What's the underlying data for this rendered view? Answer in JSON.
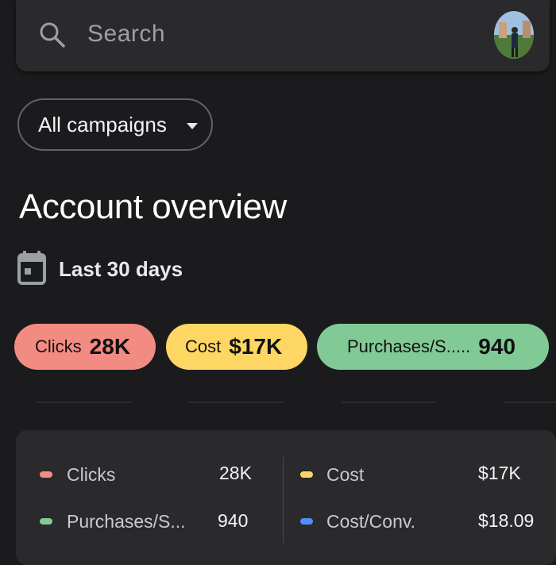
{
  "search": {
    "placeholder": "Search"
  },
  "campaign_filter": {
    "label": "All campaigns"
  },
  "page": {
    "title": "Account overview",
    "date_range": "Last 30 days"
  },
  "chips": [
    {
      "label": "Clicks",
      "value": "28K",
      "color": "#f28b82"
    },
    {
      "label": "Cost",
      "value": "$17K",
      "color": "#fdd663"
    },
    {
      "label": "Purchases/S.....",
      "value": "940",
      "color": "#81c995"
    }
  ],
  "summary": {
    "rows": [
      {
        "label": "Clicks",
        "value": "28K",
        "color": "#f28b82"
      },
      {
        "label": "Cost",
        "value": "$17K",
        "color": "#fdd663"
      },
      {
        "label": "Purchases/S...",
        "value": "940",
        "color": "#81c995"
      },
      {
        "label": "Cost/Conv.",
        "value": "$18.09",
        "color": "#4f8ff7"
      }
    ]
  },
  "icons": [
    "search-icon",
    "avatar",
    "chevron-down-icon",
    "calendar-icon"
  ]
}
